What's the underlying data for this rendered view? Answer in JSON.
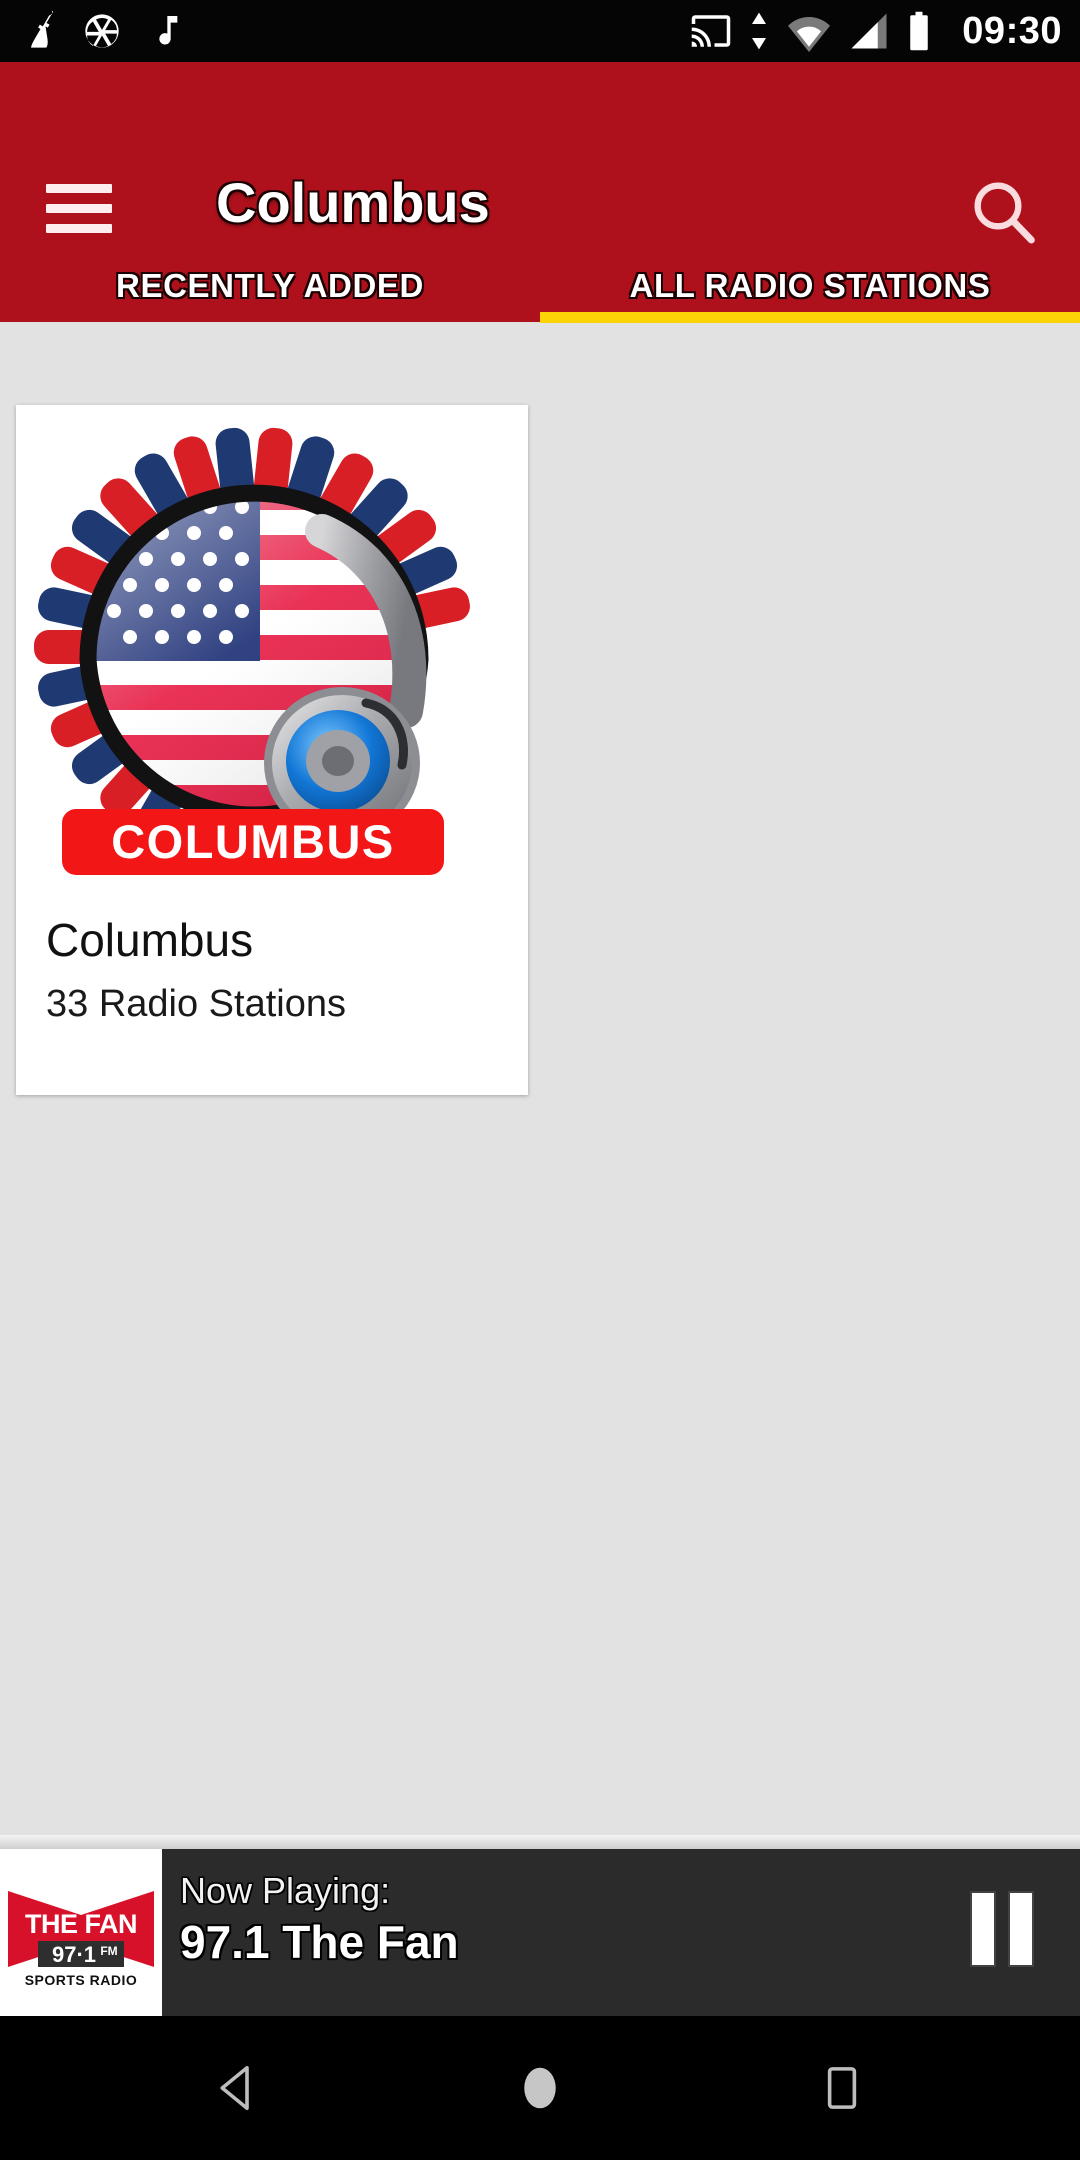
{
  "status_bar": {
    "clock": "09:30",
    "left_icons": [
      "broom-icon",
      "aperture-icon",
      "music-note-icon"
    ],
    "right_icons": [
      "cast-icon",
      "updown-arrows-icon",
      "wifi-icon",
      "cellular-signal-icon",
      "battery-icon"
    ]
  },
  "app_bar": {
    "title": "Columbus",
    "menu_icon": "hamburger-menu-icon",
    "search_icon": "search-icon",
    "background_color": "#AE111B"
  },
  "tabs": {
    "items": [
      {
        "label": "RECENTLY ADDED",
        "active": false
      },
      {
        "label": "ALL RADIO STATIONS",
        "active": true
      }
    ],
    "indicator_color": "#FCD307",
    "active_index": 1
  },
  "content": {
    "background_color": "#E2E2E2",
    "cards": [
      {
        "title": "Columbus",
        "subtitle": "33 Radio Stations",
        "artwork": {
          "alt": "columbus-usa-flag-headphones-logo",
          "banner_text": "COLUMBUS",
          "banner_color": "#F31617"
        }
      }
    ]
  },
  "now_playing": {
    "label": "Now Playing:",
    "station": "97.1 The Fan",
    "background_color": "#2B2B2B",
    "playpause_icon": "pause-icon",
    "state": "playing",
    "thumbnail": {
      "alt": "the-fan-971-fm-logo",
      "line1": "THE FAN",
      "line2": "97·1",
      "line2_suffix": "FM",
      "line3": "SPORTS RADIO",
      "color": "#D8112B"
    }
  },
  "nav_bar": {
    "buttons": [
      {
        "name": "back-button",
        "icon": "back-triangle-icon"
      },
      {
        "name": "home-button",
        "icon": "home-circle-icon"
      },
      {
        "name": "recents-button",
        "icon": "recents-square-icon"
      }
    ]
  }
}
